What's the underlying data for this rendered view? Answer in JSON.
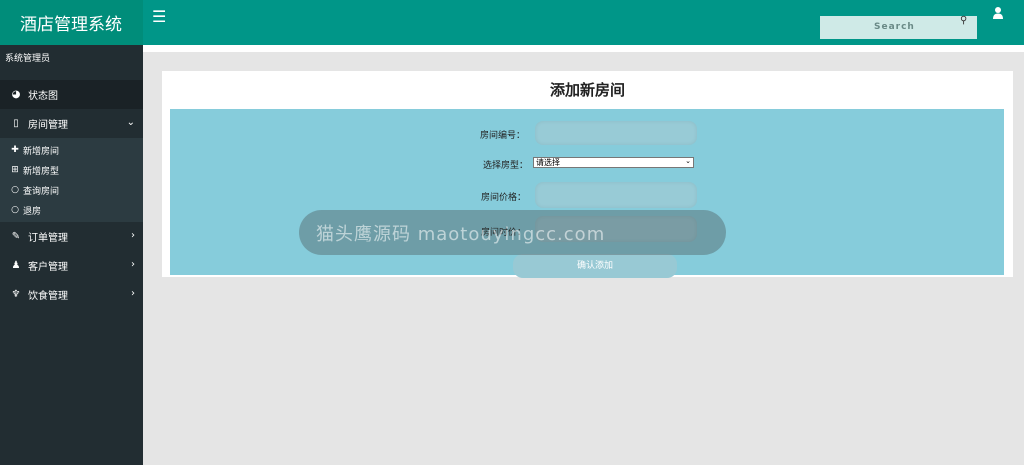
{
  "brand": {
    "title": "酒店管理系统"
  },
  "user_panel": {
    "label": "系统管理员"
  },
  "sidebar": {
    "items": [
      {
        "label": "状态图",
        "icon": "pie-chart-icon"
      },
      {
        "label": "房间管理",
        "icon": "building-icon",
        "expanded": true,
        "subitems": [
          {
            "label": "新增房间",
            "icon": "plus-icon"
          },
          {
            "label": "新增房型",
            "icon": "plus-square-icon"
          },
          {
            "label": "查询房间",
            "icon": "circle-icon"
          },
          {
            "label": "退房",
            "icon": "circle-icon"
          }
        ]
      },
      {
        "label": "订单管理",
        "icon": "edit-icon"
      },
      {
        "label": "客户管理",
        "icon": "person-icon"
      },
      {
        "label": "饮食管理",
        "icon": "cutlery-icon"
      }
    ]
  },
  "header": {
    "search_placeholder": "Search",
    "accent": "#009688"
  },
  "form": {
    "title": "添加新房间",
    "room_number_label": "房间编号：",
    "room_type_label": "选择房型：",
    "room_type_value": "请选择",
    "price_label": "房间价格：",
    "hourly_price_label": "房间时价：",
    "submit_label": "确认添加"
  },
  "watermark": {
    "text": "猫头鹰源码 maotouyingcc.com"
  }
}
